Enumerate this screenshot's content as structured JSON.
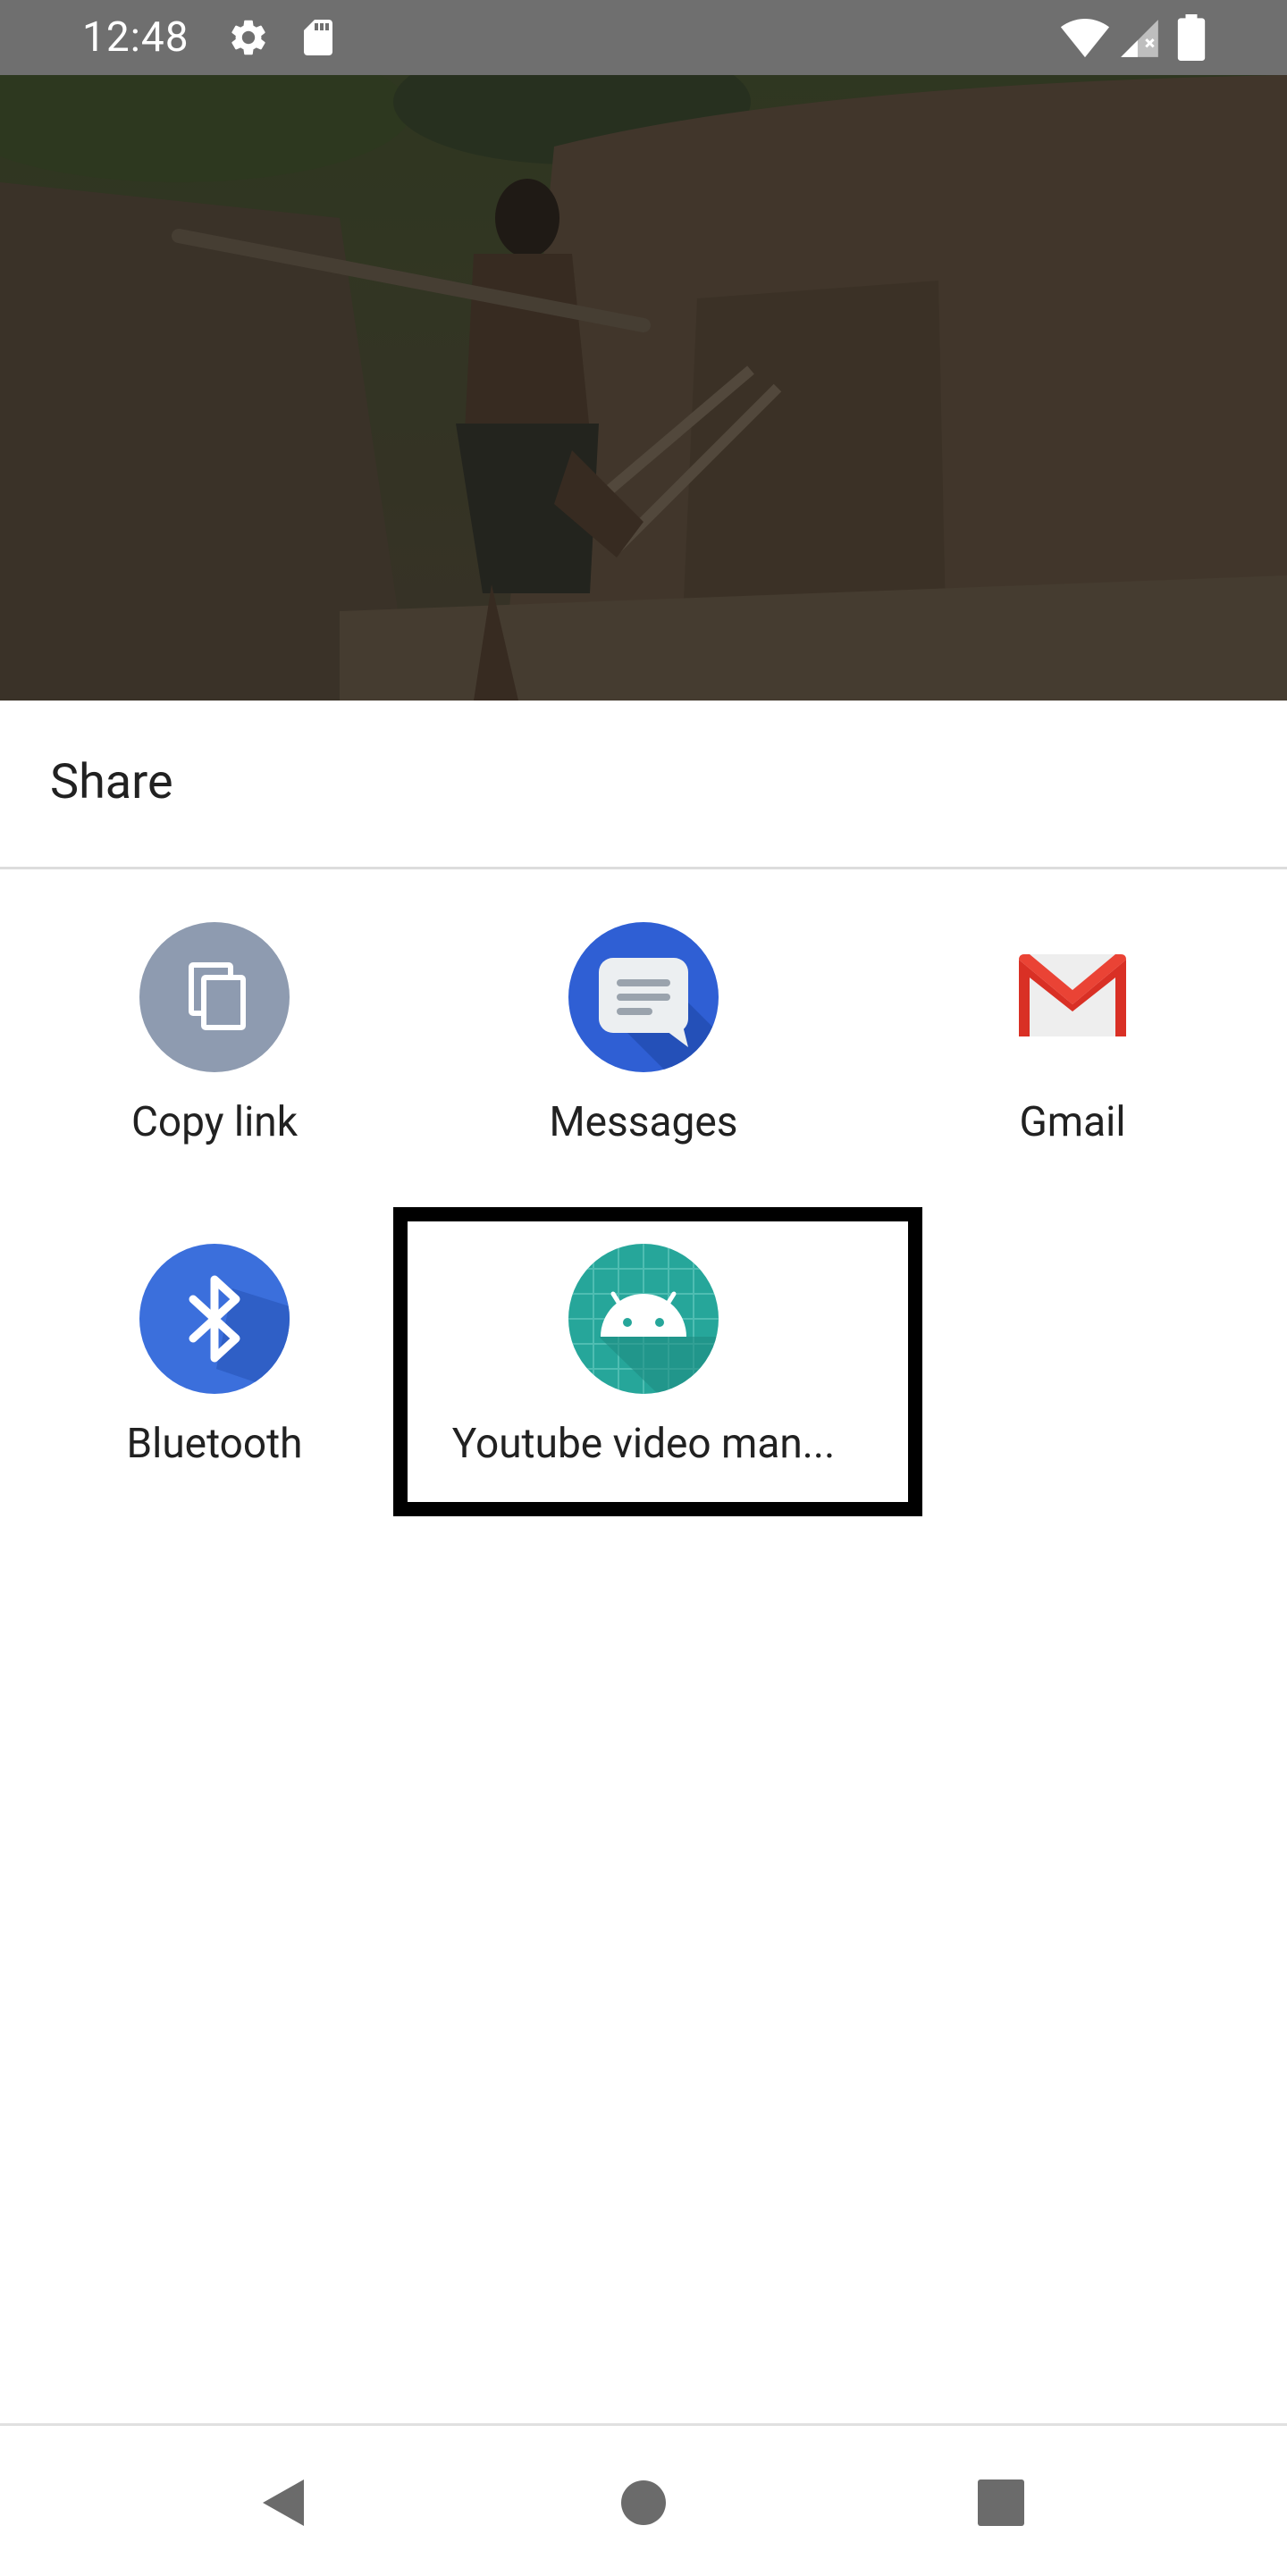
{
  "status_bar": {
    "time": "12:48",
    "icons": [
      "settings-icon",
      "sd-card-icon",
      "wifi-icon",
      "signal-icon",
      "battery-icon"
    ],
    "background": "#6f6f6f"
  },
  "sheet": {
    "title": "Share",
    "targets": [
      {
        "label": "Copy link",
        "icon": "copy-icon",
        "color": "#8e9bb0"
      },
      {
        "label": "Messages",
        "icon": "messages-icon",
        "color": "#2f5fd4"
      },
      {
        "label": "Gmail",
        "icon": "gmail-icon",
        "color": "#d93025"
      },
      {
        "label": "Bluetooth",
        "icon": "bluetooth-icon",
        "color": "#3b6fdc"
      },
      {
        "label": "Youtube video man...",
        "icon": "android-icon",
        "color": "#26a69a"
      }
    ]
  },
  "nav_bar": {
    "buttons": [
      "back-icon",
      "home-icon",
      "recents-icon"
    ]
  }
}
